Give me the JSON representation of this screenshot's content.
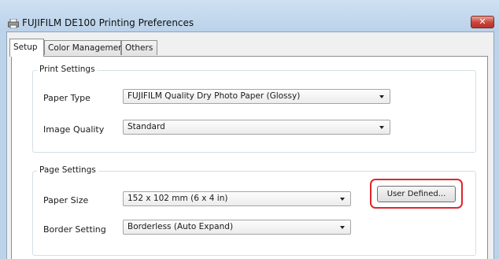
{
  "window": {
    "title": "FUJIFILM DE100 Printing Preferences",
    "close_label": "✕"
  },
  "tabs": [
    {
      "label": "Setup",
      "active": true
    },
    {
      "label": "Color Management",
      "active": false
    },
    {
      "label": "Others",
      "active": false
    }
  ],
  "print_settings": {
    "group_label": "Print Settings",
    "paper_type": {
      "label": "Paper Type",
      "value": "FUJIFILM Quality Dry Photo Paper (Glossy)"
    },
    "image_quality": {
      "label": "Image Quality",
      "value": "Standard"
    }
  },
  "page_settings": {
    "group_label": "Page Settings",
    "paper_size": {
      "label": "Paper Size",
      "value": "152 x 102 mm (6 x 4 in)"
    },
    "border_setting": {
      "label": "Border Setting",
      "value": "Borderless (Auto Expand)"
    },
    "user_defined_label": "User Defined..."
  },
  "colors": {
    "highlight": "#e0262b",
    "titlebar": "#bcd3ea",
    "close_button": "#c7443a"
  }
}
